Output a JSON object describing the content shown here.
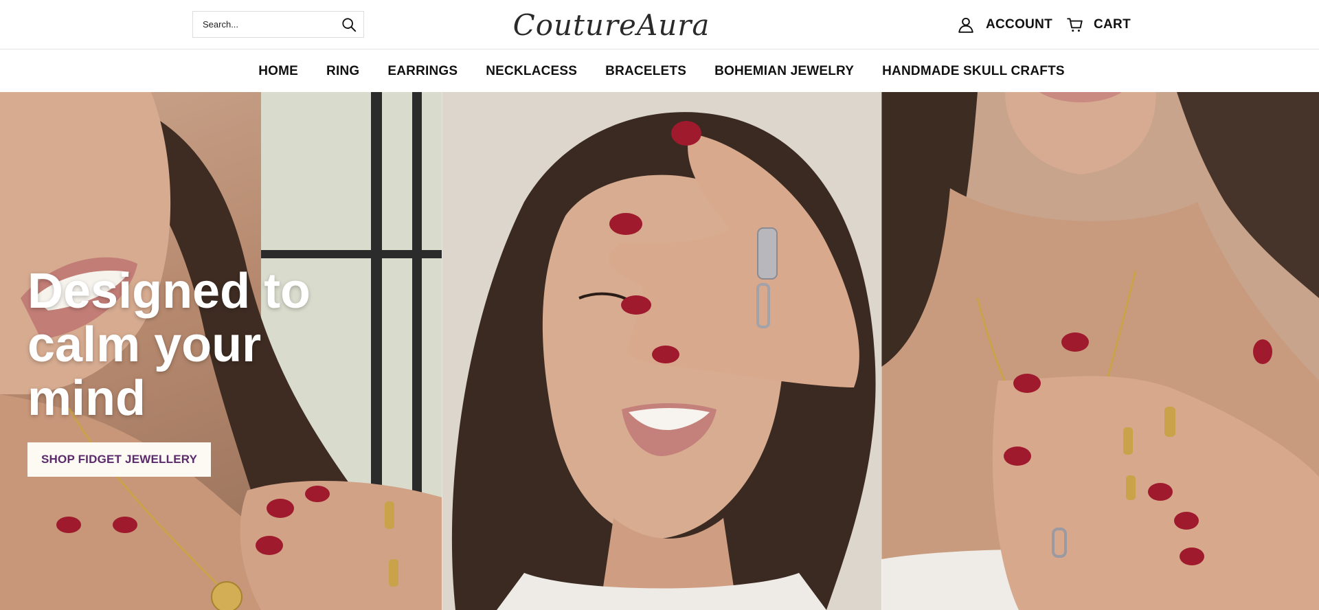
{
  "header": {
    "search": {
      "placeholder": "Search...",
      "icon": "search-icon"
    },
    "logo_text": "CoutureAura",
    "account_label": "ACCOUNT",
    "account_icon": "user-icon",
    "cart_label": "CART",
    "cart_icon": "cart-icon"
  },
  "nav": {
    "items": [
      {
        "label": "HOME"
      },
      {
        "label": "RING"
      },
      {
        "label": "EARRINGS"
      },
      {
        "label": "NECKLACESS"
      },
      {
        "label": "BRACELETS"
      },
      {
        "label": "BOHEMIAN JEWELRY"
      },
      {
        "label": "HANDMADE SKULL CRAFTS"
      }
    ]
  },
  "hero": {
    "title": "Designed to calm your mind",
    "cta_label": "SHOP FIDGET JEWELLERY",
    "panels": [
      {
        "name": "hero-photo-left"
      },
      {
        "name": "hero-photo-center"
      },
      {
        "name": "hero-photo-right"
      }
    ]
  },
  "colors": {
    "nail": "#9e1a2c",
    "skin": "#c9a28a",
    "hair": "#3a2a22",
    "cta_text": "#5a2a6b",
    "cta_bg": "#fdfaf3"
  }
}
